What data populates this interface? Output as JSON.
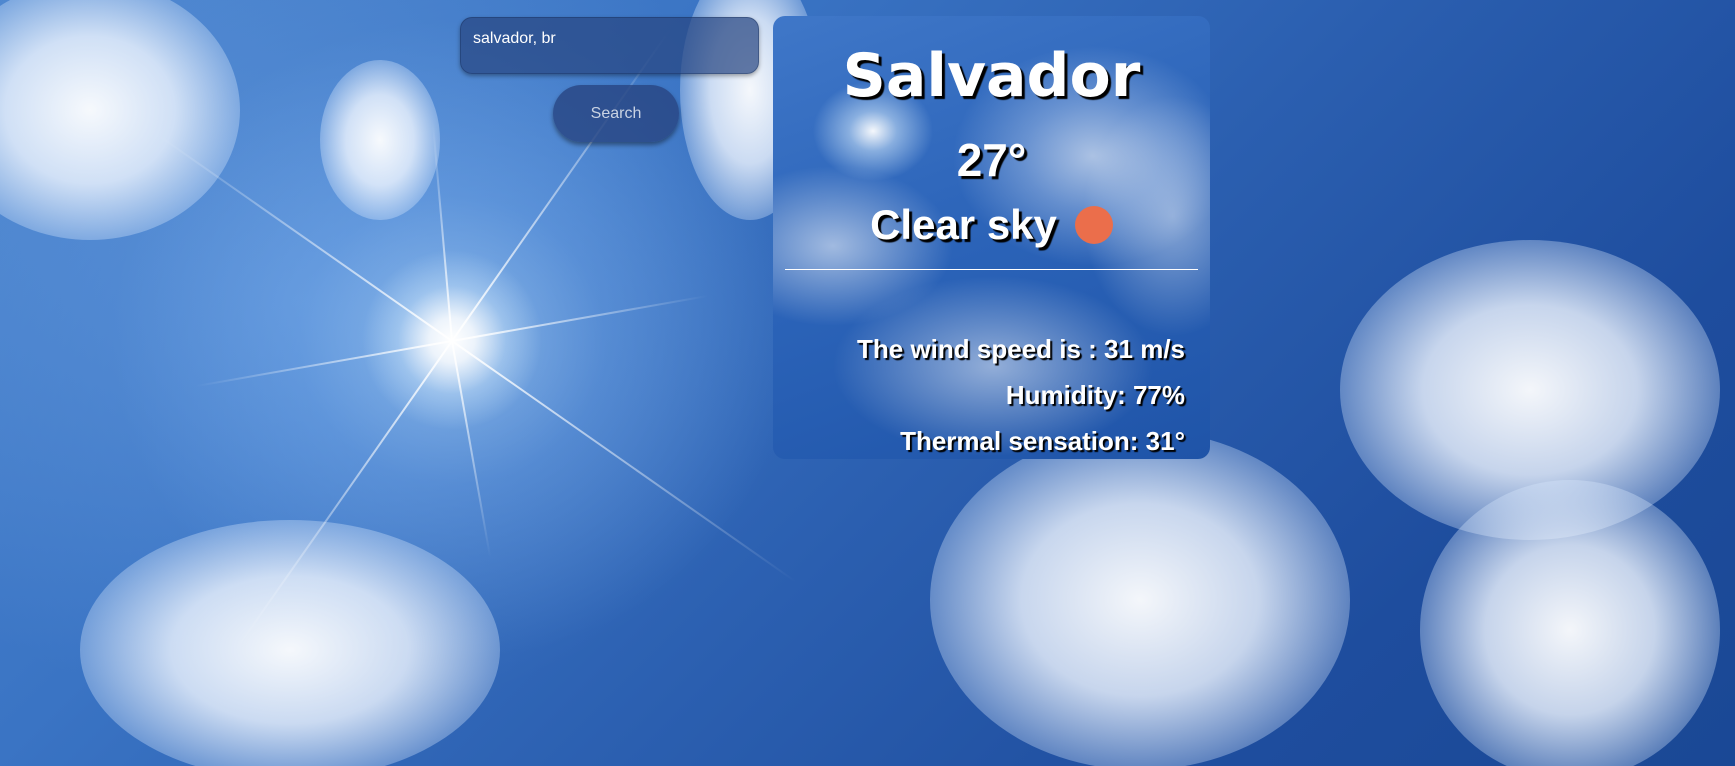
{
  "search": {
    "value": "salvador, br",
    "button_label": "Search"
  },
  "weather": {
    "city": "Salvador",
    "temperature": "27°",
    "description": "Clear sky",
    "icon": "sun-icon",
    "wind": "The wind speed is : 31 m/s",
    "humidity": "Humidity: 77%",
    "thermal": "Thermal sensation: 31°"
  },
  "colors": {
    "sun_icon": "#eb6e4b",
    "panel": "#284682",
    "text": "#ffffff",
    "text_shadow": "#000000"
  }
}
